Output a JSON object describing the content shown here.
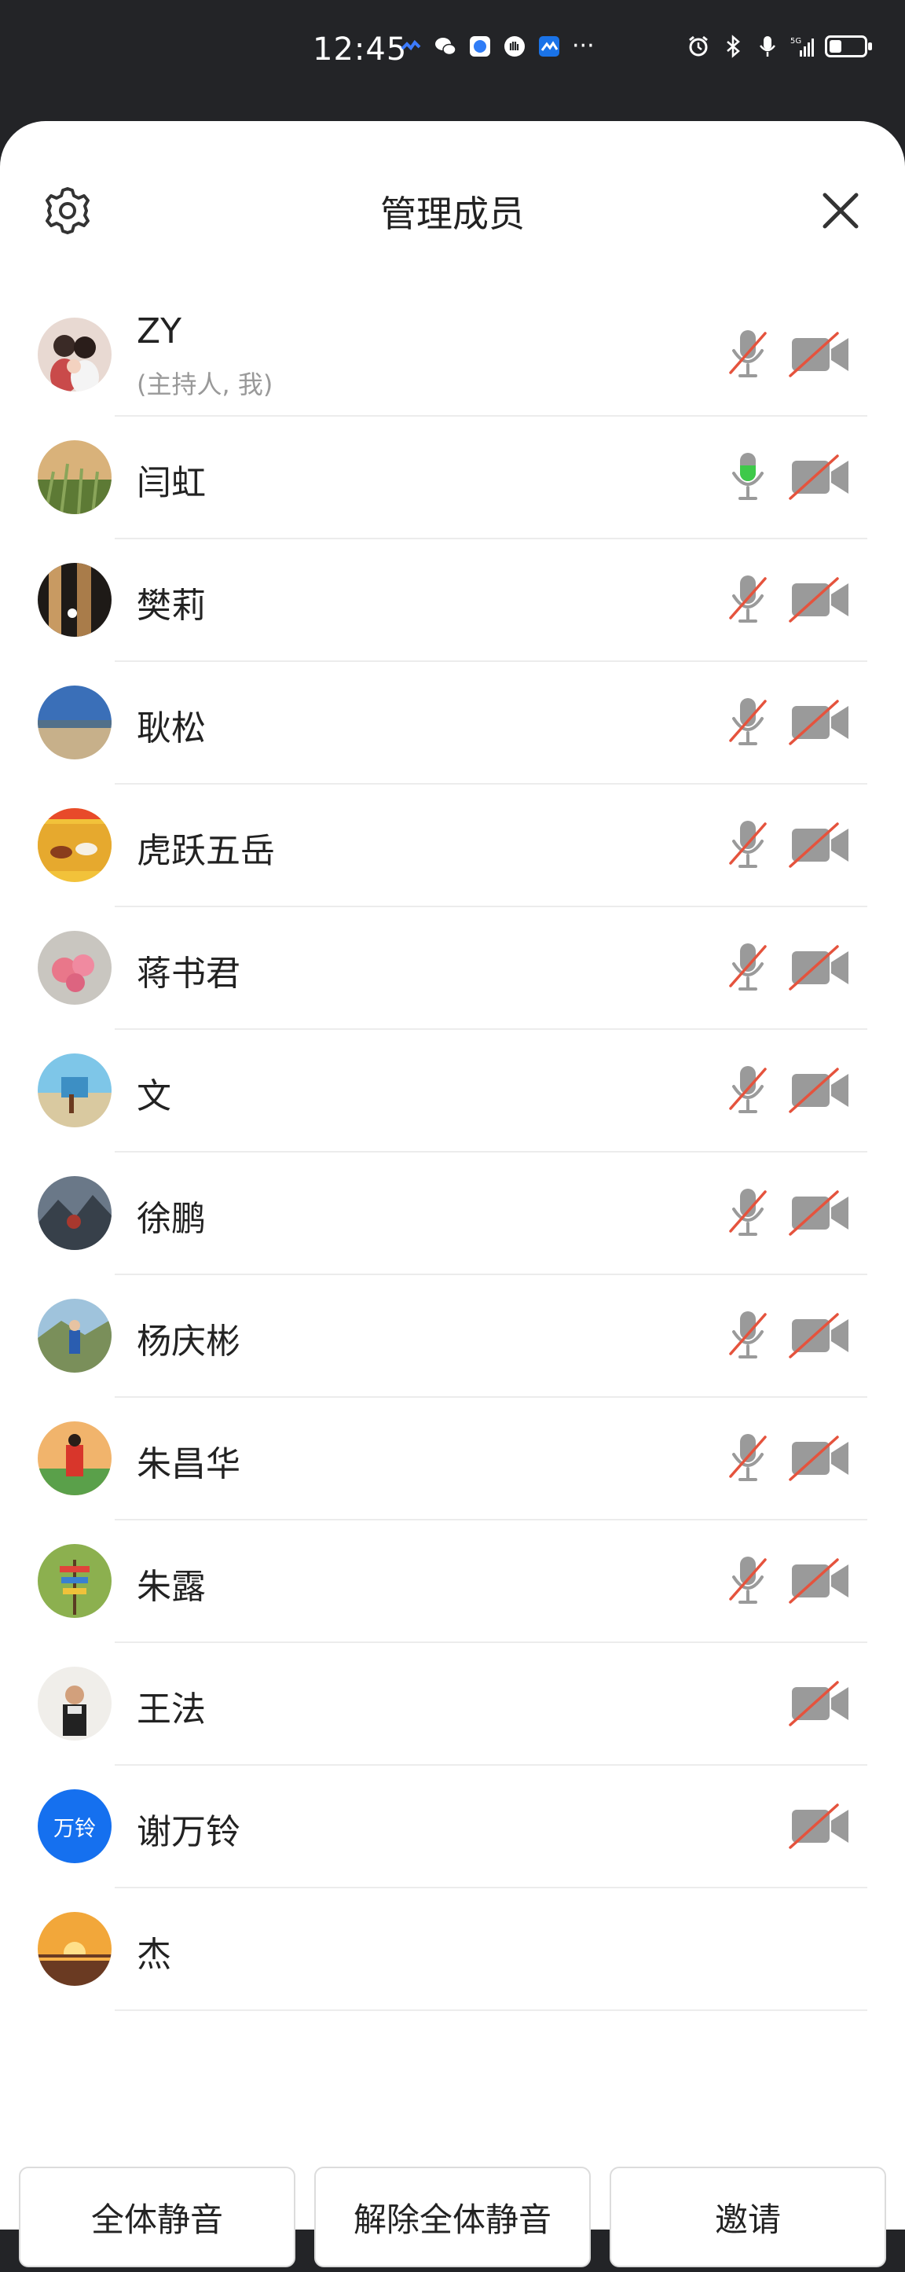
{
  "status_bar": {
    "time": "12:45",
    "left_icons": [
      "app-notification-icon",
      "wechat-icon",
      "browser-icon",
      "hand-icon",
      "app-icon",
      "more-dots-icon"
    ],
    "right_icons": [
      "alarm-icon",
      "bluetooth-icon",
      "mic-icon",
      "5g-signal-icon",
      "battery-icon"
    ],
    "battery_level": 0.35
  },
  "header": {
    "title": "管理成员",
    "settings_icon": "gear-icon",
    "close_icon": "close-icon"
  },
  "colors": {
    "mic_active": "#3ec94a",
    "slash": "#e5533d",
    "icon_gray": "#9a9a9a",
    "avatar_text_bg": "#1570ef"
  },
  "members": [
    {
      "name": "ZY",
      "role": "(主持人, 我)",
      "mic": "muted",
      "camera": "off"
    },
    {
      "name": "闫虹",
      "mic": "active",
      "camera": "off"
    },
    {
      "name": "樊莉",
      "mic": "muted",
      "camera": "off"
    },
    {
      "name": "耿松",
      "mic": "muted",
      "camera": "off"
    },
    {
      "name": "虎跃五岳",
      "mic": "muted",
      "camera": "off"
    },
    {
      "name": "蒋书君",
      "mic": "muted",
      "camera": "off"
    },
    {
      "name": "文",
      "mic": "muted",
      "camera": "off"
    },
    {
      "name": "徐鹏",
      "mic": "muted",
      "camera": "off"
    },
    {
      "name": "杨庆彬",
      "mic": "muted",
      "camera": "off"
    },
    {
      "name": "朱昌华",
      "mic": "muted",
      "camera": "off"
    },
    {
      "name": "朱露",
      "mic": "muted",
      "camera": "off"
    },
    {
      "name": "王法",
      "mic": "none",
      "camera": "off"
    },
    {
      "name": "谢万铃",
      "avatar_text": "万铃",
      "mic": "none",
      "camera": "off"
    },
    {
      "name": "杰",
      "mic": "none",
      "camera": "none"
    }
  ],
  "buttons": {
    "mute_all": "全体静音",
    "unmute_all": "解除全体静音",
    "invite": "邀请"
  }
}
